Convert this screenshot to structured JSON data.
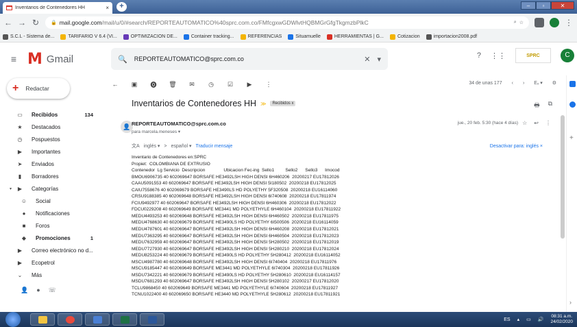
{
  "browser": {
    "tab_title": "Inventarios de Contenedores HH",
    "tab_close": "×",
    "new_tab": "+",
    "url_host": "mail.google.com",
    "url_path": "/mail/u/0/#search/REPORTEAUTOMATICO%40sprc.com.co/FMfcgxwGDWlvtHQBMGrGfgTkgmzbPlkC",
    "bookmarks": [
      "S.C.L - Sistema de...",
      "TARIFARIO V 6.4 (VI...",
      "OPTIMIZACION DE...",
      "Container tracking...",
      "REFERENCIAS",
      "Situamuelle",
      "HERRAMIENTAS | G...",
      "Cotizacion",
      "importacion2008.pdf"
    ],
    "bookmark_colors": [
      "#555555",
      "#f4b400",
      "#673ab7",
      "#1a73e8",
      "#f4b400",
      "#1a73e8",
      "#d93025",
      "#f4b400",
      "#555555"
    ]
  },
  "gmail": {
    "logo_text": "Gmail",
    "search_query": "REPORTEAUTOMATICO@sprc.com.co",
    "avatar_letter": "C",
    "compose_label": "Redactar"
  },
  "sidebar": {
    "items": [
      {
        "label": "Recibidos",
        "count": "134",
        "icon": "inbox-icon",
        "glyph": "▭",
        "active": true
      },
      {
        "label": "Destacados",
        "count": "",
        "icon": "star-icon",
        "glyph": "★"
      },
      {
        "label": "Pospuestos",
        "count": "",
        "icon": "clock-icon",
        "glyph": "◷"
      },
      {
        "label": "Importantes",
        "count": "",
        "icon": "important-icon",
        "glyph": "▶"
      },
      {
        "label": "Enviados",
        "count": "",
        "icon": "send-icon",
        "glyph": "➤"
      },
      {
        "label": "Borradores",
        "count": "",
        "icon": "draft-icon",
        "glyph": "▮"
      },
      {
        "label": "Categorías",
        "count": "",
        "icon": "label-icon",
        "glyph": "▶",
        "caret": "▾"
      },
      {
        "label": "Social",
        "count": "",
        "icon": "people-icon",
        "glyph": "☺",
        "sub": true
      },
      {
        "label": "Notificaciones",
        "count": "",
        "icon": "info-icon",
        "glyph": "●",
        "sub": true
      },
      {
        "label": "Foros",
        "count": "",
        "icon": "forum-icon",
        "glyph": "■",
        "sub": true
      },
      {
        "label": "Promociones",
        "count": "1",
        "icon": "tag-icon",
        "glyph": "◆",
        "sub": true,
        "active": true
      },
      {
        "label": "Correo electrónico no d...",
        "count": "",
        "icon": "label-icon",
        "glyph": "▶"
      },
      {
        "label": "Ecopetrol",
        "count": "",
        "icon": "label-icon",
        "glyph": "▶"
      },
      {
        "label": "Más",
        "count": "",
        "icon": "chevron-down-icon",
        "glyph": "⌄"
      }
    ]
  },
  "toolbar": {
    "pager": "34 de unas 177"
  },
  "email": {
    "subject": "Inventarios de Contenedores HH",
    "label_chip": "Recibidos x",
    "sender": "REPORTEAUTOMATICO@sprc.com.co",
    "to": "para marcela.meneses ▾",
    "date": "jue., 20 feb. 5:30 (hace 4 días)",
    "translate_from": "inglés ▾",
    "translate_arrow": ">",
    "translate_to": "español ▾",
    "translate_link": "Traducir mensaje",
    "deactivate": "Desactivar para: inglés ×",
    "body_lines": [
      "Inventario de Contenedores en:SPRC",
      "Propiet:  COLOMBIANA DE EXTRUSIO",
      "Contenedor  Lg Servicio  Descripcion               Ubicacion Fec-ing  Sello1         Sello2      Sello3      Imocod",
      "BMOU6906735 40 602069647 BORSAFE HE3492LSH HIGH DENSI 6H460206  20200217 EU17812026",
      "CAAU5091553 40 602069647 BORSAFE HE3492LSH HIGH DENSI 5I180502  20200218 EU17812025",
      "CAIU7558676 40 602069679 BORSAFE HE3490LS HD POLYETHY 5F320508  20200218 EU16114060",
      "CRSU9188385 40 602069648 BORSAFE HE3492LSH HIGH DENSI 6I740608  20200218 EU17811974",
      "FCIU9492977 40 602069647 BORSAFE HE3492LSH HIGH DENSI 6H460306  20200218 EU17812022",
      "FDCU0229208 40 602069649 BORSAFE ME3441 MD POLYETHYLE 6H460104  20200218 EU17811922",
      "MEDU4493253 40 602069648 BORSAFE HE3492LSH HIGH DENSI 6H460502  20200218 EU17811975",
      "MEDU4768630 40 602069679 BORSAFE HE3490LS HD POLYETHY 6I500506  20200218 EU16114059",
      "MEDU4787601 40 602069647 BORSAFE HE3492LSH HIGH DENSI 6H460208  20200218 EU17812021",
      "MEDU7363295 40 602069647 BORSAFE HE3492LSH HIGH DENSI 6H460504  20200218 EU17812023",
      "MEDU7632959 40 602069647 BORSAFE HE3492LSH HIGH DENSI 5H280502  20200218 EU17812019",
      "MEDU7727930 40 602069647 BORSAFE HE3492LSH HIGH DENSI 5H280210  20200218 EU17812024",
      "MEDU8253224 40 602069679 BORSAFE HE3490LS HD POLYETHY 5H280412  20200218 EU16114052",
      "MSCU4987780 40 602069648 BORSAFE HE3492LSH HIGH DENSI 6I740404  20200218 EU17811976",
      "MSCU9185447 40 602069649 BORSAFE ME3441 MD POLYETHYLE 6I740304  20200218 EU17811926",
      "MSDU7342221 40 602069679 BORSAFE HE3490LS HD POLYETHY 5H280610  20200218 EU16114157",
      "MSDU7681293 40 602069647 BORSAFE HE3492LSH HIGH DENSI 5H280102  20200217 EU17812020",
      "TCLU9868450 40 602069649 BORSAFE ME3441 MD POLYETHYLE 6I740604  20200218 EU17811927",
      "TCNU1022400 40 602069650 BORSAFE HE3440 MD POLYETHYLE 5H280612  20200218 EU17811921"
    ]
  },
  "taskbar": {
    "lang": "ES",
    "time": "08:31 a.m.",
    "date": "24/02/2020"
  }
}
